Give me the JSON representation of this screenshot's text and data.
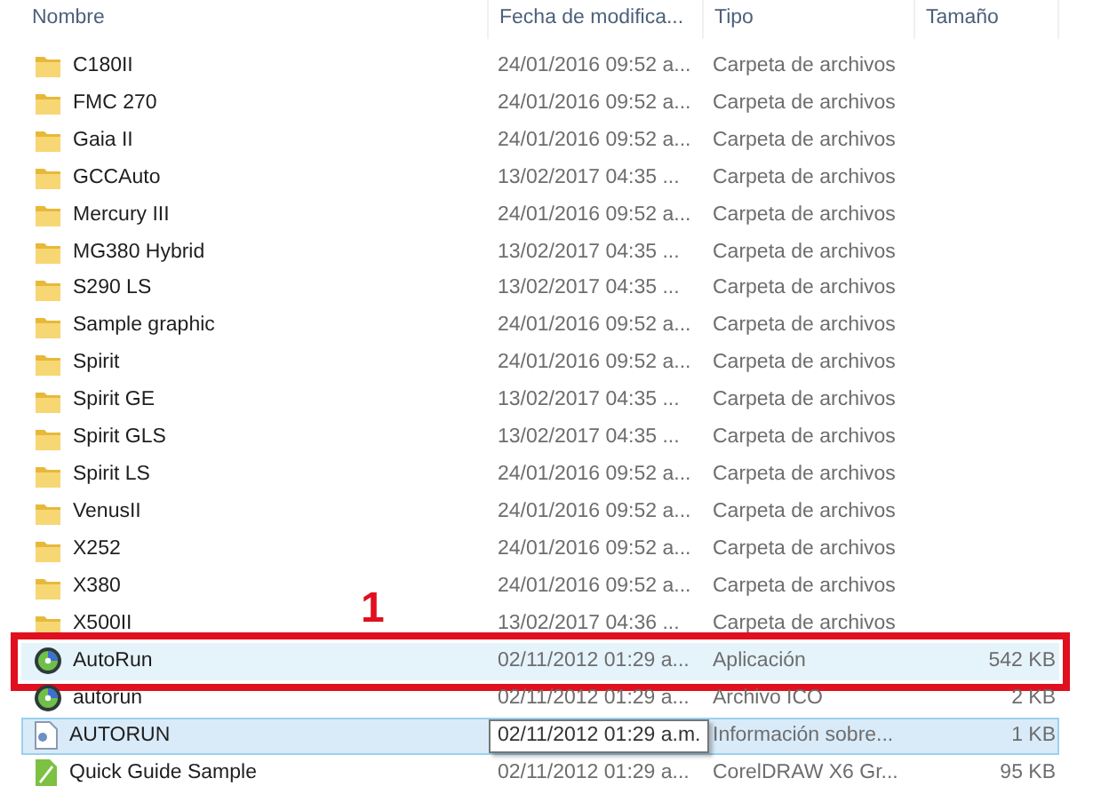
{
  "columns": [
    "Nombre",
    "Fecha de modifica...",
    "Tipo",
    "Tamaño"
  ],
  "rows": [
    {
      "kind": "folder",
      "name": "C180II",
      "date": "24/01/2016 09:52 a...",
      "type": "Carpeta de archivos",
      "selected": false,
      "hovered": false
    },
    {
      "kind": "folder",
      "name": "FMC 270",
      "date": "24/01/2016 09:52 a...",
      "type": "Carpeta de archivos",
      "selected": false,
      "hovered": false
    },
    {
      "kind": "folder",
      "name": "Gaia II",
      "date": "24/01/2016 09:52 a...",
      "type": "Carpeta de archivos",
      "selected": false,
      "hovered": false
    },
    {
      "kind": "folder",
      "name": "GCCAuto",
      "date": "13/02/2017 04:35 ...",
      "type": "Carpeta de archivos",
      "selected": false,
      "hovered": false
    },
    {
      "kind": "folder",
      "name": "Mercury III",
      "date": "24/01/2016 09:52 a...",
      "type": "Carpeta de archivos",
      "selected": false,
      "hovered": false
    },
    {
      "kind": "folder",
      "name": "MG380 Hybrid",
      "date": "13/02/2017 04:35 ...",
      "type": "Carpeta de archivos",
      "selected": false,
      "hovered": false
    },
    {
      "kind": "folder",
      "name": "S290 LS",
      "date": "13/02/2017 04:35 ...",
      "type": "Carpeta de archivos",
      "selected": false,
      "hovered": false
    },
    {
      "kind": "folder",
      "name": "Sample graphic",
      "date": "24/01/2016 09:52 a...",
      "type": "Carpeta de archivos",
      "selected": false,
      "hovered": false
    },
    {
      "kind": "folder",
      "name": "Spirit",
      "date": "24/01/2016 09:52 a...",
      "type": "Carpeta de archivos",
      "selected": false,
      "hovered": false
    },
    {
      "kind": "folder",
      "name": "Spirit GE",
      "date": "13/02/2017 04:35 ...",
      "type": "Carpeta de archivos",
      "selected": false,
      "hovered": false
    },
    {
      "kind": "folder",
      "name": "Spirit GLS",
      "date": "13/02/2017 04:35 ...",
      "type": "Carpeta de archivos",
      "selected": false,
      "hovered": false
    },
    {
      "kind": "folder",
      "name": "Spirit LS",
      "date": "24/01/2016 09:52 a...",
      "type": "Carpeta de archivos",
      "selected": false,
      "hovered": false
    },
    {
      "kind": "folder",
      "name": "VenusII",
      "date": "24/01/2016 09:52 a...",
      "type": "Carpeta de archivos",
      "selected": false,
      "hovered": false
    },
    {
      "kind": "folder",
      "name": "X252",
      "date": "24/01/2016 09:52 a...",
      "type": "Carpeta de archivos",
      "selected": false,
      "hovered": false
    },
    {
      "kind": "folder",
      "name": "X380",
      "date": "24/01/2016 09:52 a...",
      "type": "Carpeta de archivos",
      "selected": false,
      "hovered": false
    },
    {
      "kind": "folder",
      "name": "X500II",
      "date": "13/02/2017 04:36 ...",
      "type": "Carpeta de archivos",
      "selected": false,
      "hovered": false
    },
    {
      "kind": "app",
      "name": "AutoRun",
      "date": "02/11/2012 01:29 a...",
      "type": "Aplicación",
      "size": "542 KB",
      "selected": false,
      "hovered": true,
      "callout": "1"
    },
    {
      "kind": "ico",
      "name": "autorun",
      "date": "02/11/2012 01:29 a...",
      "type": "Archivo ICO",
      "size": "2 KB",
      "selected": false,
      "hovered": false
    },
    {
      "kind": "ini",
      "name": "AUTORUN",
      "type": "Información sobre...",
      "size": "1 KB",
      "selected": true,
      "hovered": false,
      "tooltip": "02/11/2012 01:29 a.m."
    },
    {
      "kind": "cdr",
      "name": "Quick Guide Sample",
      "date": "02/11/2012 01:29 a...",
      "type": "CorelDRAW X6 Gr...",
      "size": "95 KB",
      "selected": false,
      "hovered": false
    }
  ]
}
